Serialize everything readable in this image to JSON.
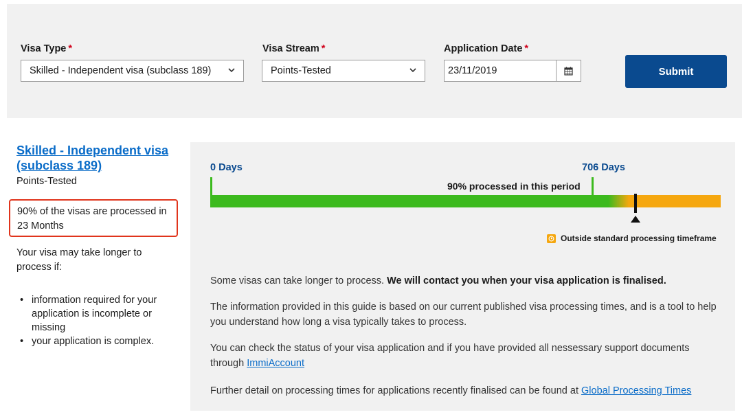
{
  "form": {
    "visa_type": {
      "label": "Visa Type",
      "required": "*",
      "value": "Skilled - Independent visa (subclass 189)"
    },
    "visa_stream": {
      "label": "Visa Stream",
      "required": "*",
      "value": "Points-Tested"
    },
    "application_date": {
      "label": "Application Date",
      "required": "*",
      "value": "23/11/2019",
      "icon": "calendar-icon"
    },
    "submit_label": "Submit"
  },
  "result": {
    "visa_title": "Skilled - Independent visa (subclass 189)",
    "visa_stream": "Points-Tested",
    "processed_text": "90% of the visas are processed in 23 Months",
    "longer_intro": "Your visa may take longer to process if:",
    "reasons": [
      "information required for your application is incomplete or missing",
      "your application is complex."
    ]
  },
  "timeline": {
    "start_label": "0 Days",
    "end_label": "706 Days",
    "caption": "90% processed in this period",
    "legend": "Outside standard processing timeframe",
    "colors": {
      "within": "#3cba1e",
      "outside": "#f5a70f",
      "marker": "#111111"
    }
  },
  "info": {
    "p1_text": "Some visas can take longer to process. ",
    "p1_bold": "We will contact you when your visa application is finalised.",
    "p2": "The information provided in this guide is based on our current published visa processing times, and is a tool to help you understand how long a visa typically takes to process.",
    "p3_text": "You can check the status of your visa application and if you have provided all nessessary support documents through ",
    "p3_link": "ImmiAccount",
    "p4_text": "Further detail on processing times for applications recently finalised can be found at ",
    "p4_link": "Global Processing Times"
  },
  "colors": {
    "brand": "#0a4a8f",
    "link": "#0a6cc8",
    "highlight": "#e0341c"
  }
}
